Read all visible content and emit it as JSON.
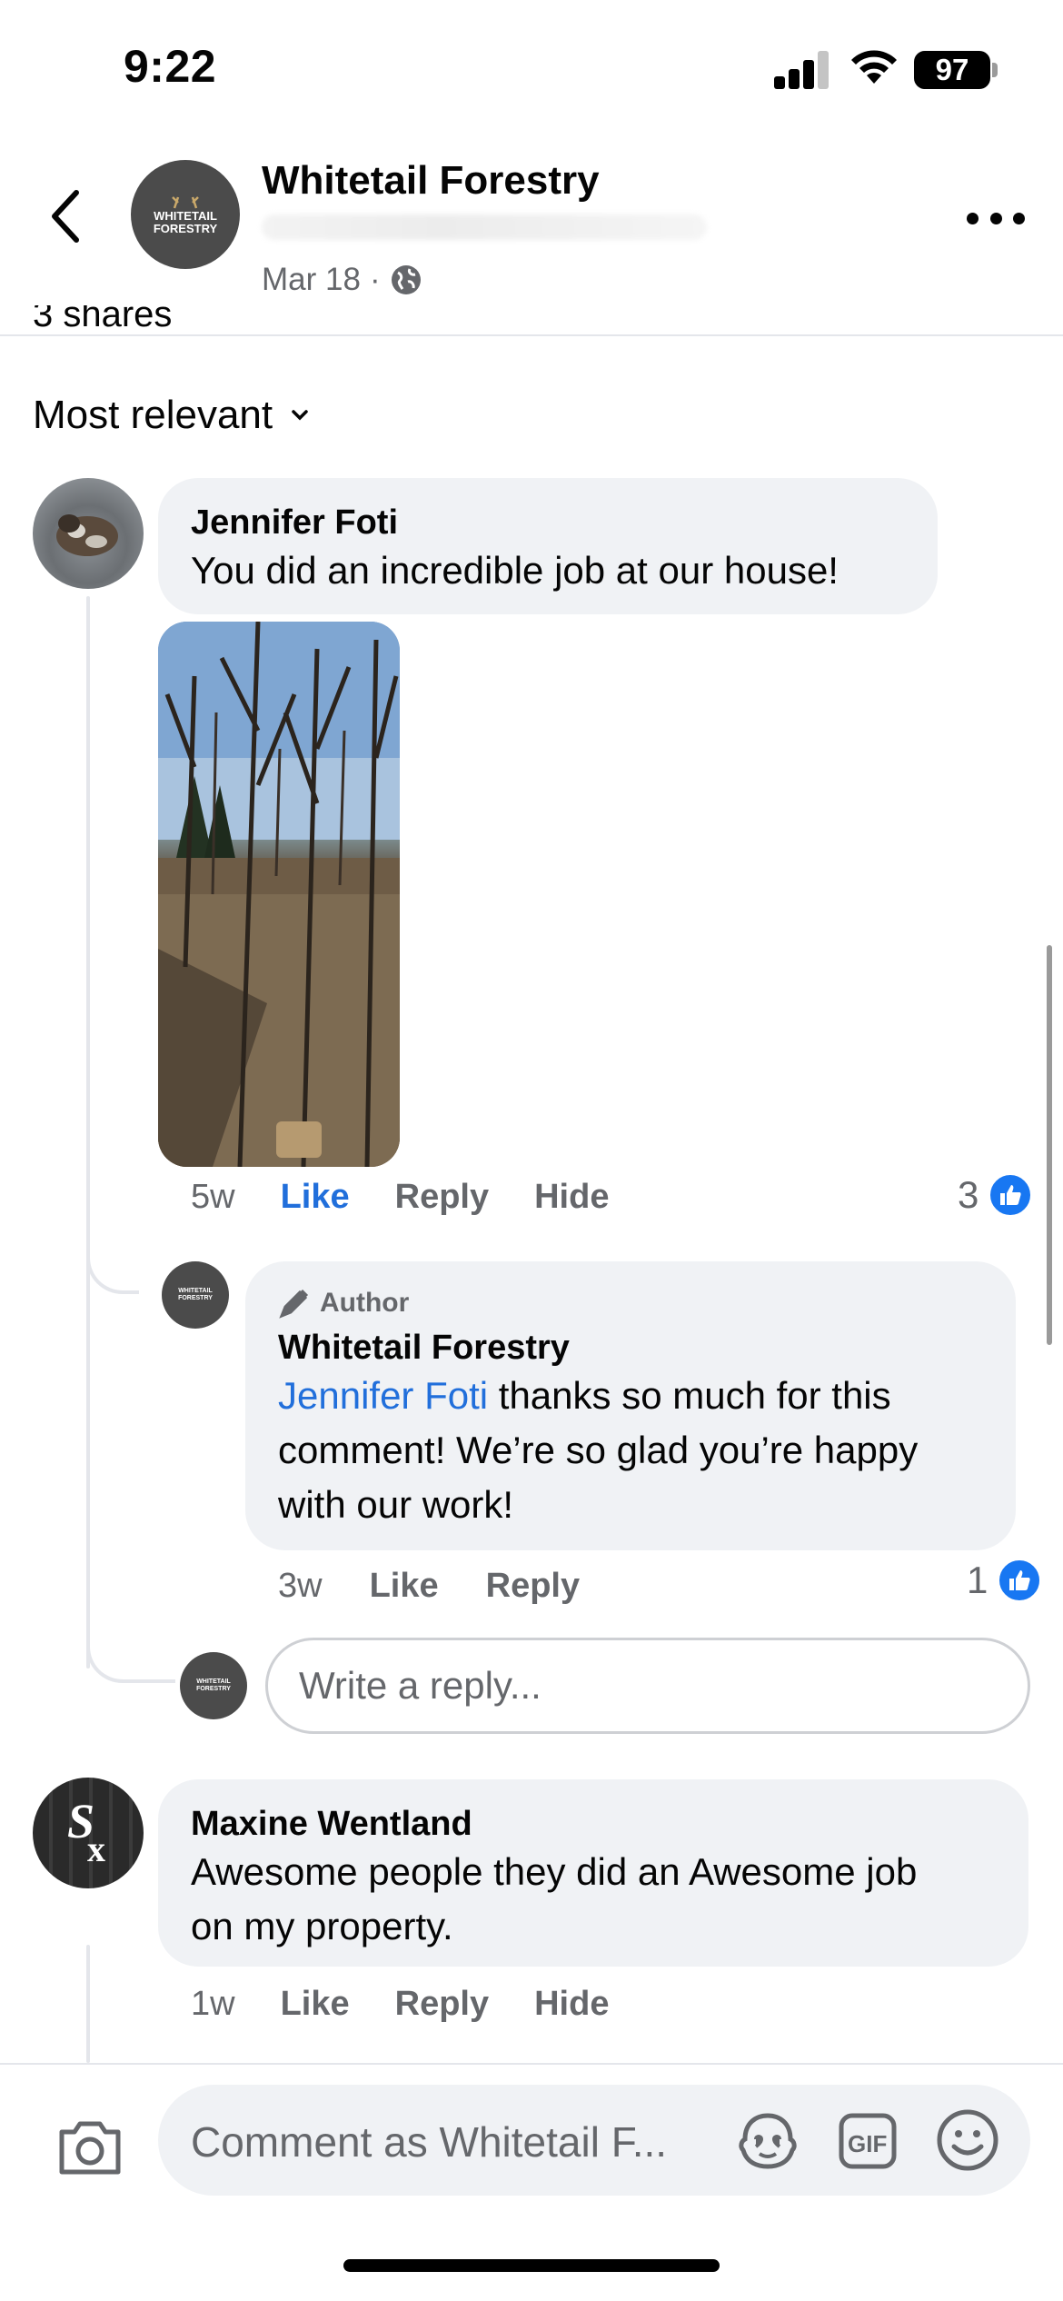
{
  "status_bar": {
    "time": "9:22",
    "battery": "97"
  },
  "header": {
    "page_name": "Whitetail Forestry",
    "date": "Mar 18",
    "separator": "·",
    "logo_text": [
      "WHITETAIL",
      "FORESTRY"
    ]
  },
  "partial_text": "3 shares",
  "sort": {
    "label": "Most relevant"
  },
  "comments": [
    {
      "author": "Jennifer Foti",
      "text": "You did an incredible job at our house!",
      "time": "5w",
      "like": "Like",
      "reply": "Reply",
      "hide": "Hide",
      "reactions": "3",
      "replies": [
        {
          "badge": "Author",
          "author": "Whitetail Forestry",
          "mention": "Jennifer Foti",
          "text_lines": [
            " thanks so much for this",
            "comment! We’re so glad you’re happy",
            "with our work!"
          ],
          "time": "3w",
          "like": "Like",
          "reply": "Reply",
          "reactions": "1"
        }
      ],
      "reply_placeholder": "Write a reply..."
    },
    {
      "author": "Maxine Wentland",
      "text_lines": [
        "Awesome people they did an Awesome  job",
        "on my property."
      ],
      "time": "1w",
      "like": "Like",
      "reply": "Reply",
      "hide": "Hide"
    }
  ],
  "composer": {
    "placeholder": "Comment as Whitetail F..."
  },
  "icons": [
    "back-arrow-icon",
    "more-icon",
    "globe-icon",
    "chevron-down-icon",
    "like-icon",
    "pencil-icon",
    "camera-icon",
    "avatar-sticker-icon",
    "gif-icon",
    "emoji-icon"
  ],
  "colors": {
    "link": "#216fdb",
    "like": "#1877f2",
    "bubble": "#f0f2f5",
    "secondary_text": "#65676b"
  }
}
